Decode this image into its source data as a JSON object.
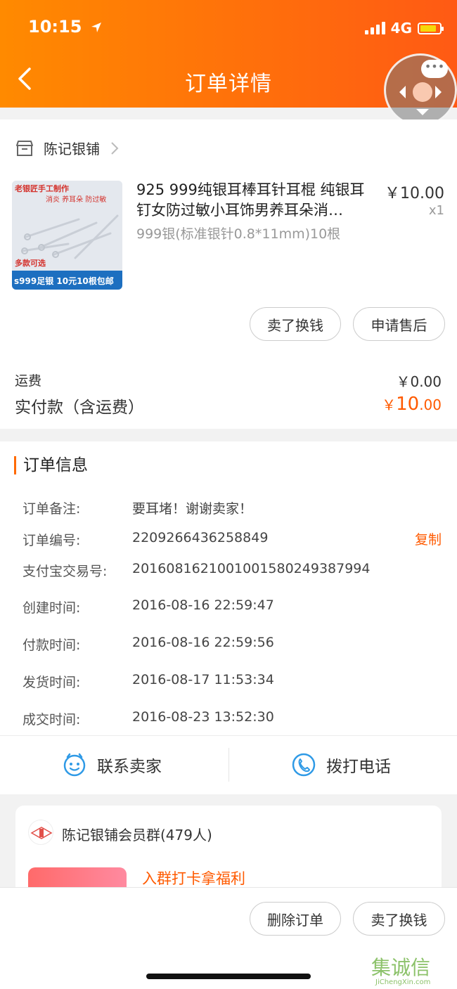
{
  "status_bar": {
    "time": "10:15",
    "network": "4G"
  },
  "header": {
    "title": "订单详情"
  },
  "shop": {
    "name": "陈记银铺"
  },
  "product": {
    "title": "925 999纯银耳棒耳针耳棍 纯银耳钉女防过敏小耳饰男养耳朵消…",
    "spec": "999银(标准银针0.8*11mm)10根",
    "price": "￥10.00",
    "qty": "x1",
    "image_texts": {
      "line1": "老银匠手工制作",
      "line2": "消炎  养耳朵  防过敏",
      "line3": "多款可选",
      "line4": "s999足银 10元10根包邮"
    }
  },
  "product_actions": {
    "sell": "卖了换钱",
    "after_sale": "申请售后"
  },
  "fees": {
    "shipping_label": "运费",
    "shipping_value": "￥0.00",
    "paid_label": "实付款（含运费）",
    "paid_symbol": "￥",
    "paid_int": "10",
    "paid_dec": ".00"
  },
  "order_info": {
    "heading": "订单信息",
    "copy_label": "复制",
    "rows": [
      {
        "label": "订单备注:",
        "value": "要耳堵！谢谢卖家！"
      },
      {
        "label": "订单编号:",
        "value": "2209266436258849"
      },
      {
        "label": "支付宝交易号:",
        "value": "2016081621001001580249387994"
      },
      {
        "label": "创建时间:",
        "value": "2016-08-16 22:59:47"
      },
      {
        "label": "付款时间:",
        "value": "2016-08-16 22:59:56"
      },
      {
        "label": "发货时间:",
        "value": "2016-08-17 11:53:34"
      },
      {
        "label": "成交时间:",
        "value": "2016-08-23 13:52:30"
      }
    ]
  },
  "contact": {
    "seller": "联系卖家",
    "call": "拨打电话"
  },
  "group": {
    "name": "陈记银铺会员群(479人)",
    "promo": "入群打卡拿福利"
  },
  "bottom_actions": {
    "delete": "删除订单",
    "sell": "卖了换钱"
  },
  "watermark": {
    "cn": "集诚信",
    "en": "JiChengXin.com"
  },
  "colors": {
    "accent": "#ff5a00",
    "header_start": "#ff8a00",
    "header_end": "#ff5a14",
    "icon_blue": "#2f9ae6"
  }
}
